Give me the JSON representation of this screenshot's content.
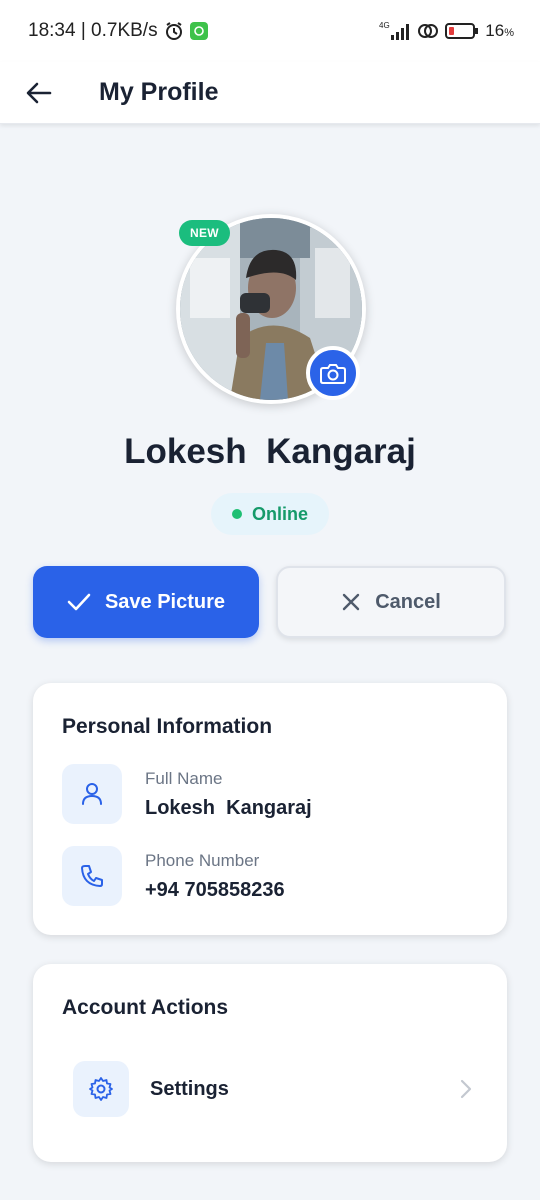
{
  "status_bar": {
    "time_speed": "18:34 | 0.7KB/s",
    "network_label": "4G",
    "battery": "16",
    "battery_unit": "%"
  },
  "header": {
    "title": "My Profile"
  },
  "profile": {
    "badge": "NEW",
    "name": "Lokesh  Kangaraj",
    "status": "Online"
  },
  "buttons": {
    "save_label": "Save Picture",
    "cancel_label": "Cancel"
  },
  "personal_info": {
    "title": "Personal Information",
    "fields": [
      {
        "label": "Full Name",
        "value": "Lokesh  Kangaraj",
        "icon": "user-icon"
      },
      {
        "label": "Phone Number",
        "value": "+94 705858236",
        "icon": "phone-icon"
      }
    ]
  },
  "account_actions": {
    "title": "Account Actions",
    "items": [
      {
        "label": "Settings",
        "icon": "gear-icon"
      }
    ]
  },
  "colors": {
    "primary": "#2a62e8",
    "online": "#1fbf73",
    "badge": "#1bbd7e",
    "background": "#f2f5f9"
  }
}
